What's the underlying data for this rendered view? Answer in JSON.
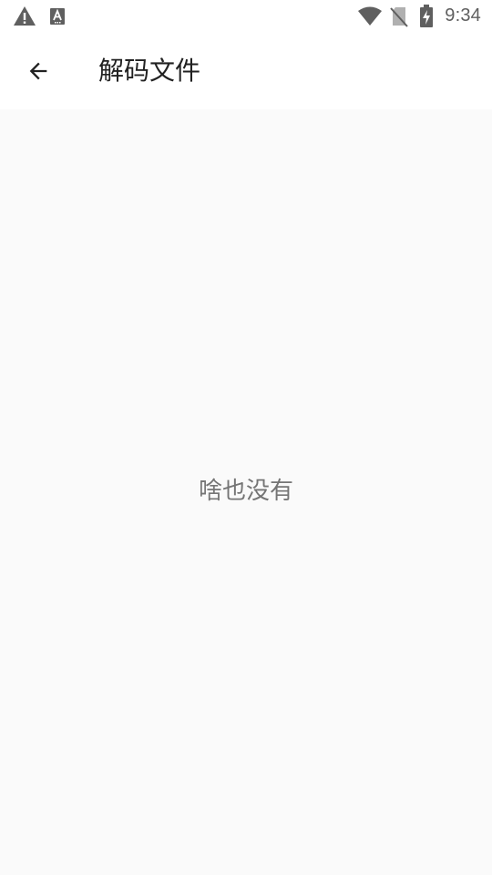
{
  "status_bar": {
    "time": "9:34",
    "left_icons": [
      "warning-icon",
      "font-a-icon"
    ],
    "right_icons": [
      "wifi-icon",
      "no-sim-icon",
      "battery-charging-icon"
    ]
  },
  "app_bar": {
    "back_icon": "arrow-back-icon",
    "title": "解码文件"
  },
  "content": {
    "empty_message": "啥也没有"
  },
  "colors": {
    "background": "#fafafa",
    "app_bar": "#ffffff",
    "title_text": "#212121",
    "empty_text": "#757575",
    "status_icons": "#5f5f5f"
  }
}
